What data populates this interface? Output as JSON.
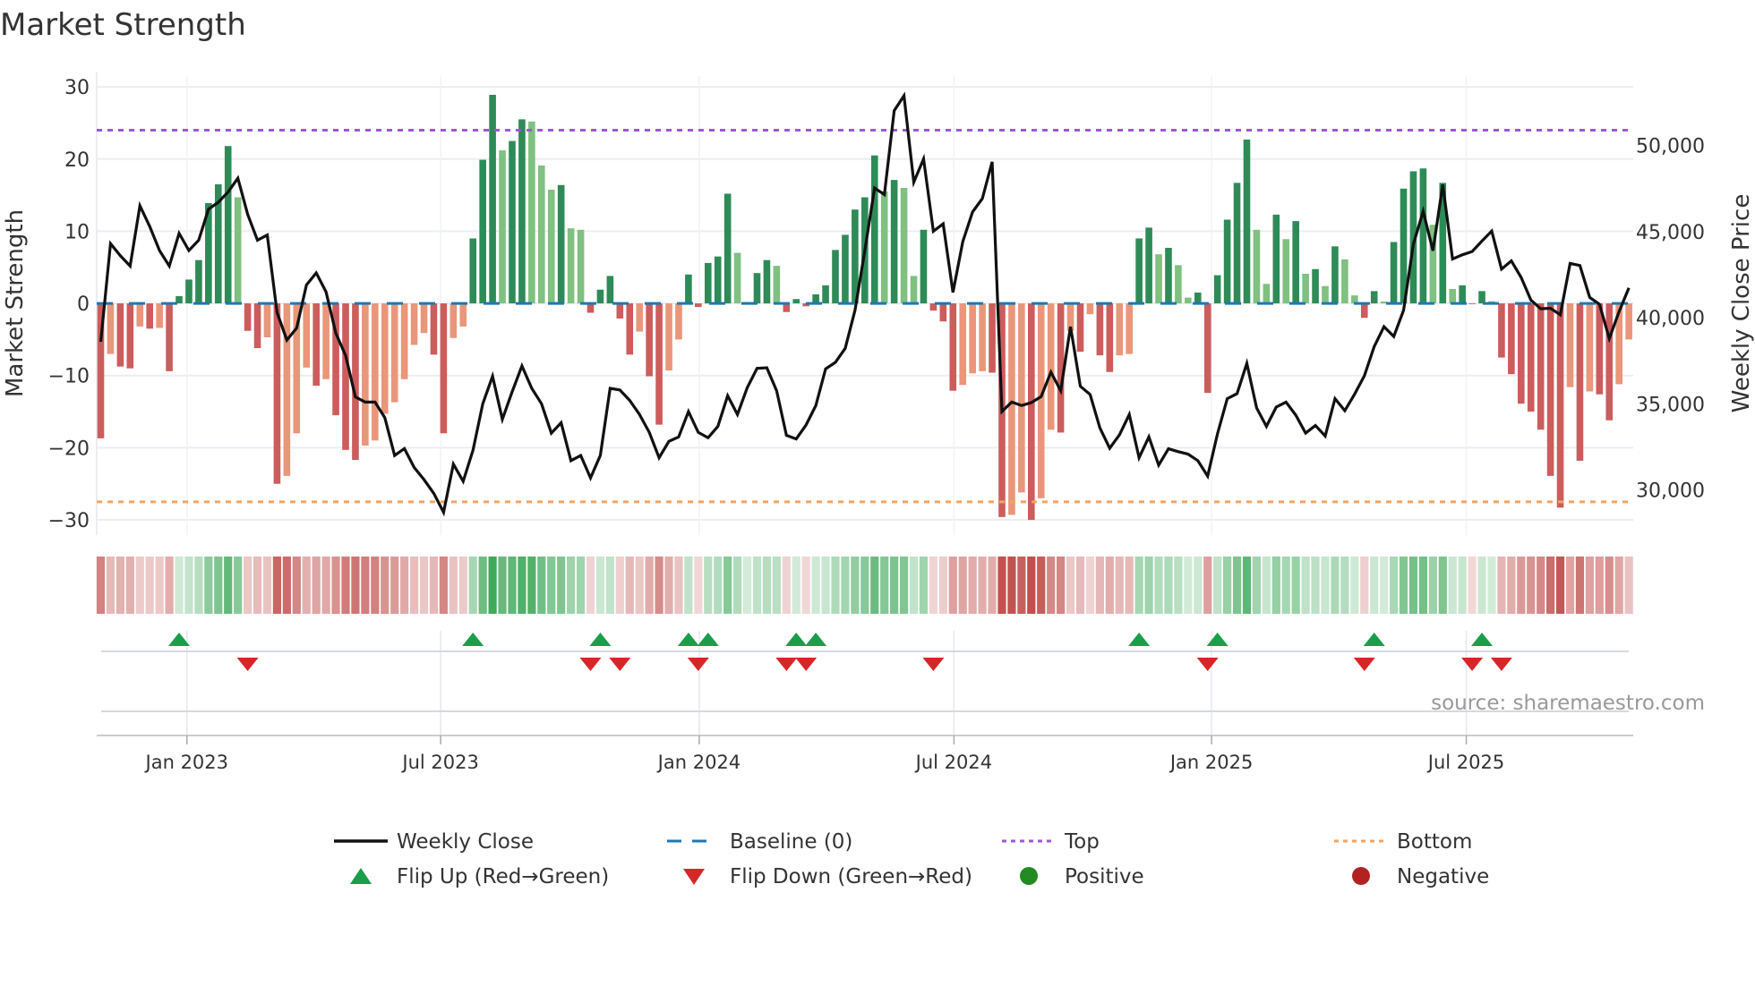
{
  "chart_data": {
    "type": "bar",
    "title": "Market Strength",
    "ylabel": "Market Strength",
    "y2label": "Weekly Close Price",
    "ylim": [
      -32.1,
      31.5
    ],
    "y2lim": [
      27380,
      54030
    ],
    "yticks": [
      30,
      20,
      10,
      0,
      -10,
      -20,
      -30
    ],
    "ytick_labels": [
      "30",
      "20",
      "10",
      "0",
      "−10",
      "−20",
      "−30"
    ],
    "y2ticks": [
      50000,
      45000,
      40000,
      35000,
      30000
    ],
    "y2tick_labels": [
      "50,000",
      "45,000",
      "40,000",
      "35,000",
      "30,000"
    ],
    "x_unit": "week index",
    "xticks": [
      8.8,
      34.7,
      61.1,
      87.1,
      113.4,
      139.4
    ],
    "xtick_labels": [
      "Jan 2023",
      "Jul 2023",
      "Jan 2024",
      "Jul 2024",
      "Jan 2025",
      "Jul 2025"
    ],
    "top_level": 24,
    "bottom_level": -27.5,
    "baseline": 0,
    "strength": [
      -18.7,
      -7,
      -8.75,
      -9,
      -3.2,
      -3.5,
      -3.4,
      -9.4,
      1,
      3.3,
      6,
      13.9,
      16.5,
      21.8,
      14.7,
      -3.8,
      -6.2,
      -4.7,
      -25,
      -23.9,
      -18,
      -8.9,
      -11.4,
      -10.5,
      -15.5,
      -20.3,
      -21.7,
      -19.7,
      -19,
      -15.3,
      -13.7,
      -10.5,
      -5.75,
      -4.1,
      -7.1,
      -18,
      -4.8,
      -3.2,
      9,
      19.9,
      28.9,
      21.2,
      22.5,
      25.5,
      25.2,
      19.1,
      15.75,
      16.4,
      10.4,
      10.2,
      -1.3,
      1.9,
      3.8,
      -2.1,
      -7.1,
      -3.9,
      -10.1,
      -16.8,
      -9.3,
      -5,
      4,
      -0.5,
      5.6,
      6.5,
      15.2,
      7,
      0.2,
      4.2,
      6,
      5.2,
      -1.2,
      0.6,
      -0.4,
      1.25,
      2.5,
      7.4,
      9.5,
      13,
      14.7,
      20.5,
      15.5,
      17.1,
      16,
      3.8,
      10.2,
      -1,
      -2.5,
      -12.1,
      -11.3,
      -9.7,
      -9.4,
      -9.6,
      -29.6,
      -29.3,
      -26.2,
      -30,
      -27,
      -17.5,
      -17.9,
      -3.8,
      -6.7,
      -1.5,
      -7.2,
      -9.5,
      -7.2,
      -7,
      9,
      10.5,
      6.8,
      7.7,
      5.3,
      0.8,
      1.5,
      -12.4,
      3.9,
      11.6,
      16.7,
      22.7,
      10.2,
      2.7,
      12.3,
      8.9,
      11.4,
      4.1,
      4.75,
      2.4,
      7.9,
      6.1,
      1.1,
      -2,
      1.7,
      0.25,
      8.5,
      15.9,
      18.3,
      18.7,
      10.9,
      16.7,
      2,
      2.5,
      -0.1,
      1.7,
      0.3,
      -7.5,
      -9.8,
      -13.9,
      -15,
      -17.5,
      -23.9,
      -28.3,
      -11.6,
      -21.8,
      -12.2,
      -12.6,
      -16.2,
      -11.2,
      -5
    ],
    "weekly_close": [
      38600,
      44300,
      43600,
      43000,
      46500,
      45300,
      43900,
      43000,
      44900,
      43900,
      44500,
      46300,
      46700,
      47300,
      48100,
      46000,
      44500,
      44800,
      40300,
      38700,
      39400,
      41900,
      42600,
      41500,
      39100,
      37800,
      35400,
      35100,
      35100,
      34200,
      32000,
      32400,
      31300,
      30600,
      29800,
      28700,
      31500,
      30500,
      32300,
      35000,
      36600,
      34100,
      35700,
      37200,
      35900,
      35000,
      33300,
      33900,
      31700,
      32000,
      30700,
      32000,
      35900,
      35800,
      35200,
      34380,
      33340,
      31870,
      32820,
      33080,
      34550,
      33340,
      33030,
      33690,
      35470,
      34380,
      35940,
      37060,
      37090,
      35760,
      33170,
      32960,
      33770,
      34900,
      37030,
      37410,
      38220,
      40430,
      43890,
      47530,
      47150,
      52020,
      52890,
      47870,
      49220,
      45020,
      45450,
      41470,
      44410,
      46140,
      46920,
      49050,
      34550,
      35100,
      34900,
      35070,
      35420,
      36840,
      35760,
      39480,
      36020,
      35540,
      33600,
      32420,
      33200,
      34380,
      31870,
      33080,
      31440,
      32390,
      32220,
      32080,
      31700,
      30800,
      33250,
      35300,
      35590,
      37350,
      34760,
      33690,
      34810,
      35100,
      34340,
      33300,
      33740,
      33130,
      35300,
      34600,
      35560,
      36630,
      38320,
      39480,
      38910,
      40430,
      44270,
      46180,
      43890,
      47730,
      43410,
      43650,
      43840,
      44450,
      45030,
      42820,
      43300,
      42340,
      41020,
      40520,
      40550,
      40170,
      43150,
      43030,
      41180,
      40780,
      38790,
      40350,
      41730
    ],
    "flip_up": [
      8,
      38,
      51,
      60,
      62,
      71,
      73,
      106,
      114,
      130,
      141
    ],
    "flip_down": [
      15,
      50,
      53,
      61,
      70,
      72,
      85,
      113,
      129,
      140,
      143
    ],
    "grid": true,
    "legend_position": "bottom",
    "annotation": "source: sharemaestro.com"
  },
  "legend": [
    {
      "label": "Weekly Close",
      "kind": "line"
    },
    {
      "label": "Baseline (0)",
      "kind": "dash"
    },
    {
      "label": "Top",
      "kind": "dot-top"
    },
    {
      "label": "Bottom",
      "kind": "dot-bottom"
    },
    {
      "label": "Flip Up (Red→Green)",
      "kind": "tri-up"
    },
    {
      "label": "Flip Down (Green→Red)",
      "kind": "tri-down"
    },
    {
      "label": "Positive",
      "kind": "dot-pos"
    },
    {
      "label": "Negative",
      "kind": "dot-neg"
    }
  ],
  "colors": {
    "pos_dark": "#2e8b57",
    "pos_light": "#80c080",
    "neg_dark": "#cd5c5c",
    "neg_light": "#e9967a",
    "line": "#111111",
    "baseline": "#1f77b4",
    "top": "#9b59d0",
    "bottom": "#f4a460",
    "up": "#1a9e4a",
    "down": "#d62728",
    "positive": "#228b22",
    "negative": "#b22222",
    "strip_pos": [
      58,
      166,
      85
    ],
    "strip_neg": [
      192,
      80,
      77
    ]
  }
}
